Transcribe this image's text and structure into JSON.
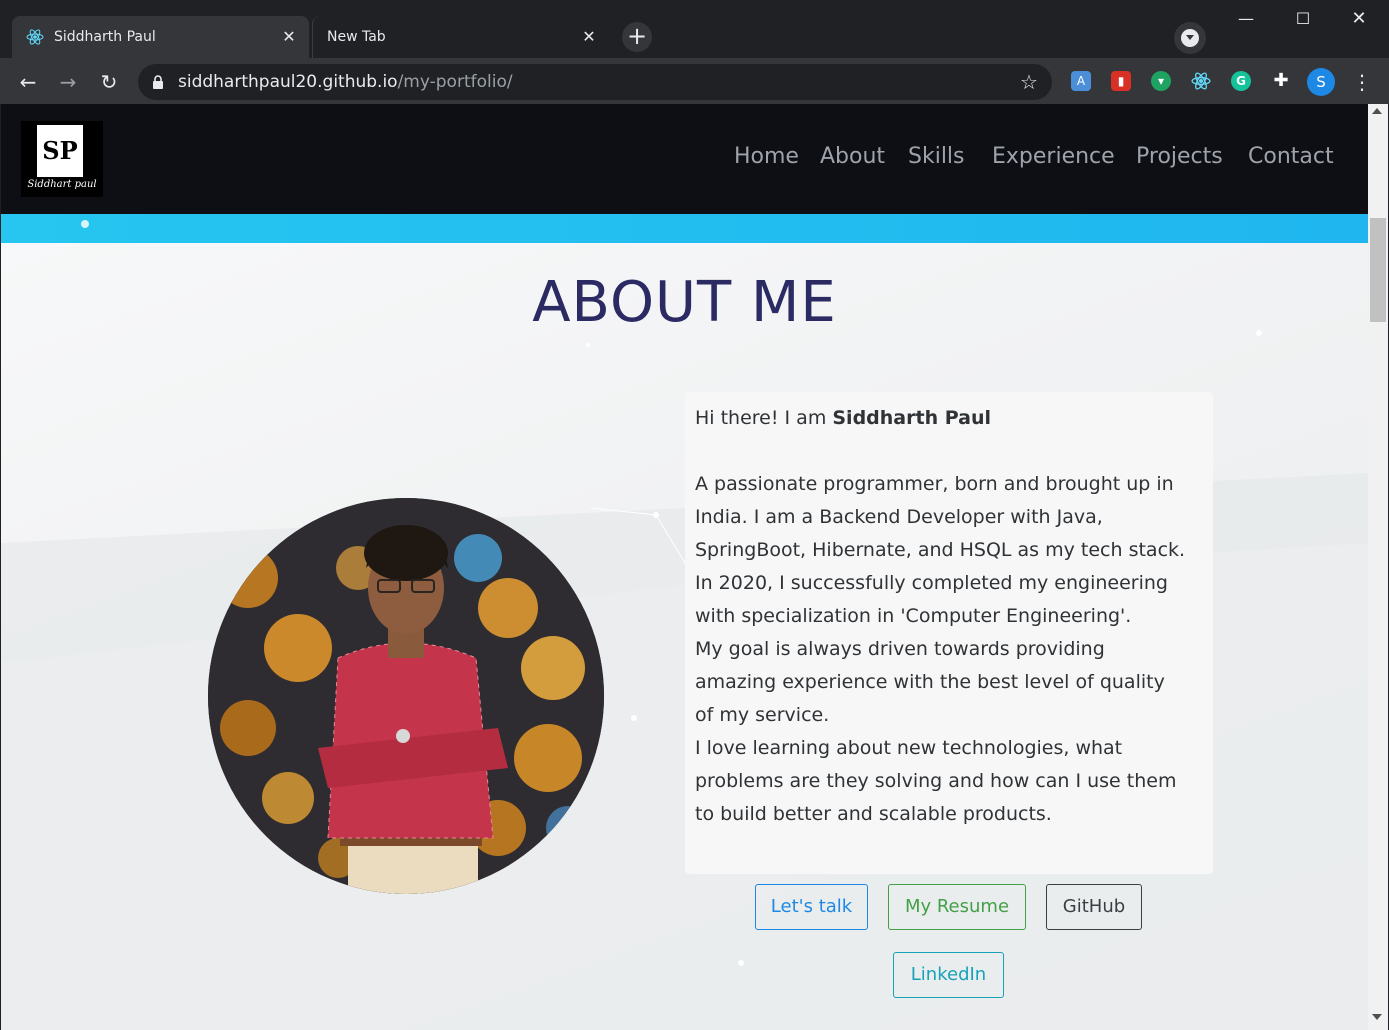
{
  "browser": {
    "tabs": [
      {
        "title": "Siddharth Paul",
        "icon": "react-icon",
        "active": true
      },
      {
        "title": "New Tab",
        "active": false
      }
    ],
    "url_host": "siddharthpaul20.github.io",
    "url_path": "/my-portfolio/",
    "profile_initial": "S",
    "extensions": [
      "translate-icon",
      "bookmark-ext-icon",
      "cart-ext-icon",
      "react-devtools-icon",
      "grammarly-icon",
      "puzzle-icon"
    ]
  },
  "site": {
    "logo": {
      "initials": "SP",
      "signature": "Siddhart paul"
    },
    "nav": [
      "Home",
      "About",
      "Skills",
      "Experience",
      "Projects",
      "Contact"
    ],
    "heading": "ABOUT ME",
    "intro_prefix": "Hi there! I am ",
    "intro_name": "Siddharth Paul",
    "bio_lines": [
      "A passionate programmer, born and brought up in",
      "India. I am a Backend Developer with Java,",
      "SpringBoot, Hibernate, and HSQL as my tech stack.",
      "In 2020, I successfully completed my engineering",
      "with specialization in 'Computer Engineering'.",
      "My goal is always driven towards providing",
      "amazing experience with the best level of quality",
      "of my service.",
      "I love learning about new technologies, what",
      "problems are they solving and how can I use them",
      "to build better and scalable products."
    ],
    "buttons": {
      "talk": "Let's talk",
      "resume": "My Resume",
      "github": "GitHub",
      "linkedin": "LinkedIn"
    },
    "colors": {
      "accent_blue": "#1e88e5",
      "resume_green": "#43a047",
      "linkedin_teal": "#17a2b8",
      "heading": "#2b2a63",
      "bluebar": "#26c6f0"
    }
  }
}
